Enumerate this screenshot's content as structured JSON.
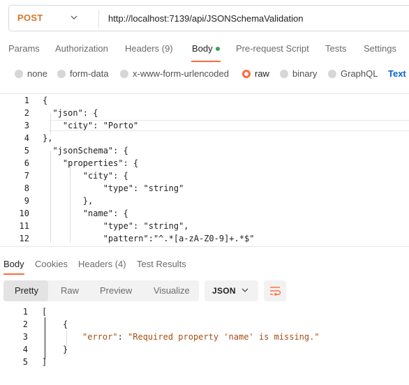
{
  "request": {
    "method": "POST",
    "url": "http://localhost:7139/api/JSONSchemaValidation"
  },
  "request_tabs": {
    "params": "Params",
    "authorization": "Authorization",
    "headers": "Headers (9)",
    "body": "Body",
    "prerequest": "Pre-request Script",
    "tests": "Tests",
    "settings": "Settings"
  },
  "body_modes": {
    "none": "none",
    "form_data": "form-data",
    "urlencoded": "x-www-form-urlencoded",
    "raw": "raw",
    "binary": "binary",
    "graphql": "GraphQL",
    "text": "Text",
    "selected": "raw"
  },
  "editor": {
    "line_numbers": [
      "1",
      "2",
      "3",
      "4",
      "5",
      "6",
      "7",
      "8",
      "9",
      "10",
      "11",
      "12"
    ],
    "lines": [
      "{",
      "  \"json\": {",
      "    \"city\": \"Porto\"",
      "},",
      "  \"jsonSchema\": {",
      "    \"properties\": {",
      "        \"city\": {",
      "            \"type\": \"string\"",
      "        },",
      "        \"name\": {",
      "            \"type\": \"string\",",
      "            \"pattern\":\"^.*[a-zA-Z0-9]+.*$\""
    ]
  },
  "response_tabs": {
    "body": "Body",
    "cookies": "Cookies",
    "headers": "Headers (4)",
    "test_results": "Test Results"
  },
  "response_views": {
    "pretty": "Pretty",
    "raw": "Raw",
    "preview": "Preview",
    "visualize": "Visualize",
    "format": "JSON"
  },
  "response": {
    "line_numbers": [
      "1",
      "2",
      "3",
      "4",
      "5"
    ],
    "l1": "[",
    "l2": "{",
    "l3_key": "\"error\"",
    "l3_sep": ": ",
    "l3_val": "\"Required property 'name' is missing.\"",
    "l4": "}",
    "l5": "]"
  }
}
